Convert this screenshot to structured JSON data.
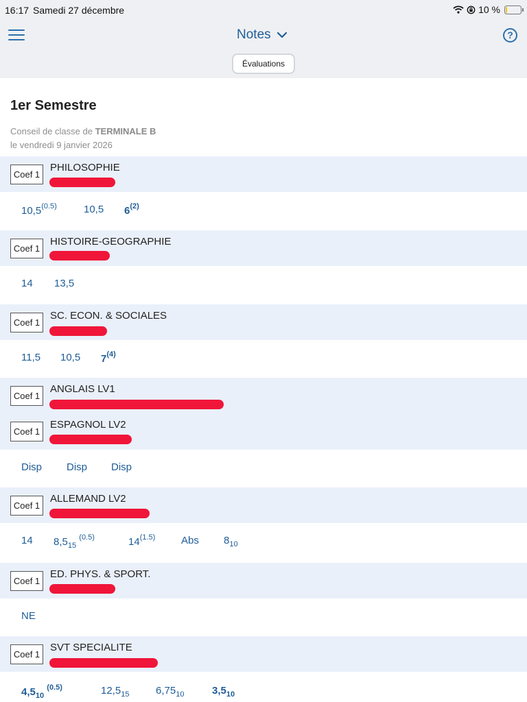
{
  "status": {
    "time": "16:17",
    "date": "Samedi 27 décembre",
    "battery": "10 %",
    "battery_level": 0.1
  },
  "header": {
    "title": "Notes",
    "evaluations_label": "Évaluations"
  },
  "semester": {
    "title": "1er Semestre",
    "conseil_prefix": "Conseil de classe de",
    "class_name": "TERMINALE B",
    "date_line": "le vendredi 9 janvier 2026"
  },
  "coef_label": "Coef 1",
  "subjects": [
    {
      "name": "PHILOSOPHIE",
      "grades": [
        {
          "value": "10,5",
          "sup": "(0.5)"
        },
        {
          "value": "10,5"
        },
        {
          "value": "6",
          "sup": "(2)",
          "bold": true
        }
      ]
    },
    {
      "name": "HISTOIRE-GEOGRAPHIE",
      "grades": [
        {
          "value": "14"
        },
        {
          "value": "13,5"
        }
      ]
    },
    {
      "name": "SC. ECON. & SOCIALES",
      "grades": [
        {
          "value": "11,5"
        },
        {
          "value": "10,5"
        },
        {
          "value": "7",
          "sup": "(4)",
          "bold": true
        }
      ]
    },
    {
      "name": "ANGLAIS LV1"
    },
    {
      "name": "ESPAGNOL LV2",
      "grades": [
        {
          "value": "Disp"
        },
        {
          "value": "Disp"
        },
        {
          "value": "Disp"
        }
      ]
    },
    {
      "name": "ALLEMAND LV2",
      "grades": [
        {
          "value": "14"
        },
        {
          "value": "8,5",
          "sub": "15",
          "sup": "(0.5)"
        },
        {
          "value": "14",
          "sup": "(1.5)"
        },
        {
          "value": "Abs"
        },
        {
          "value": "8",
          "sub": "10"
        }
      ]
    },
    {
      "name": "ED. PHYS. & SPORT.",
      "grades": [
        {
          "value": "NE"
        }
      ]
    },
    {
      "name": "SVT SPECIALITE",
      "grades": [
        {
          "value": "4,5",
          "sub": "10",
          "sup": "(0.5)",
          "bold": true
        },
        {
          "value": "12,5",
          "sub": "15"
        },
        {
          "value": "6,75",
          "sub": "10"
        },
        {
          "value": "3,5",
          "sub": "10",
          "bold": true
        }
      ]
    }
  ]
}
